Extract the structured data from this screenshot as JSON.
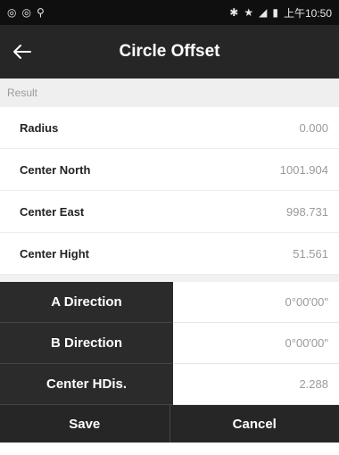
{
  "status_bar": {
    "left_icons": [
      "circle-icon",
      "circle-icon",
      "location-pin-icon"
    ],
    "right_icons": [
      "bluetooth-icon",
      "star-icon",
      "signal-icon",
      "battery-icon"
    ],
    "time": "上午10:50"
  },
  "header": {
    "title": "Circle Offset",
    "back_icon": "arrow-left-icon"
  },
  "result_section": {
    "title": "Result",
    "rows": [
      {
        "label": "Radius",
        "value": "0.000"
      },
      {
        "label": "Center North",
        "value": "1001.904"
      },
      {
        "label": "Center East",
        "value": "998.731"
      },
      {
        "label": "Center Hight",
        "value": "51.561"
      }
    ]
  },
  "inputs": [
    {
      "label": "A Direction",
      "value": "0°00'00\""
    },
    {
      "label": "B Direction",
      "value": "0°00'00\""
    },
    {
      "label": "Center HDis.",
      "value": "2.288"
    }
  ],
  "buttons": {
    "save": "Save",
    "cancel": "Cancel"
  },
  "colors": {
    "bar_dark": "#262626",
    "status_bg": "#0f0f0f",
    "section_bg": "#efefef",
    "value_text": "#9a9a9a"
  }
}
